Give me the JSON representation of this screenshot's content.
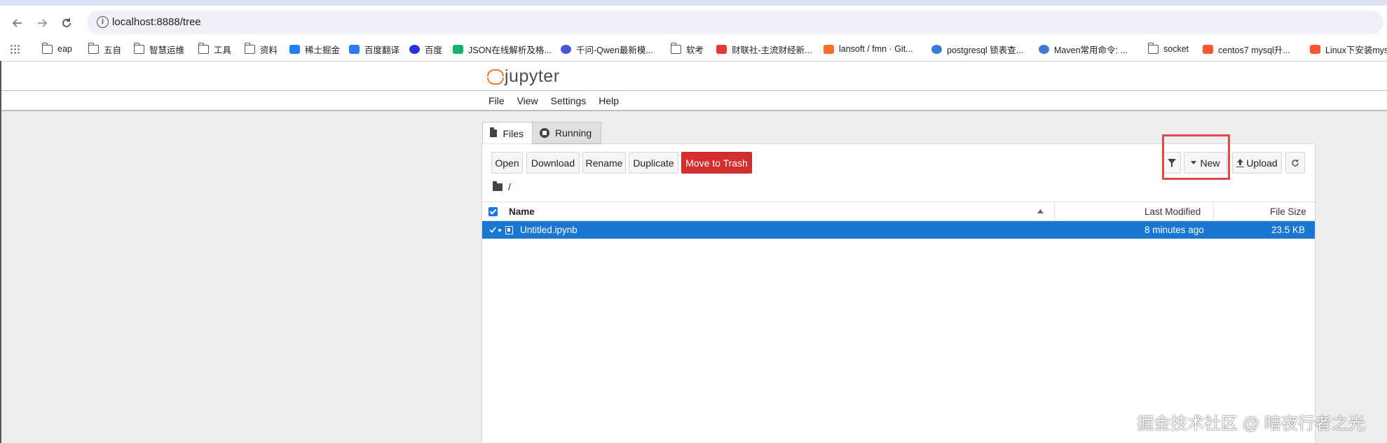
{
  "browser": {
    "url": "localhost:8888/tree",
    "bookmarks": [
      {
        "label": "eap",
        "icon": "folder-icon"
      },
      {
        "label": "五自",
        "icon": "folder-icon"
      },
      {
        "label": "智慧运维",
        "icon": "folder-icon"
      },
      {
        "label": "工具",
        "icon": "folder-icon"
      },
      {
        "label": "资料",
        "icon": "folder-icon"
      },
      {
        "label": "稀土掘金",
        "icon": "juejin-icon"
      },
      {
        "label": "百度翻译",
        "icon": "baidu-translate-icon"
      },
      {
        "label": "百度",
        "icon": "baidu-icon"
      },
      {
        "label": "JSON在线解析及格...",
        "icon": "json-icon"
      },
      {
        "label": "千问-Qwen最新模...",
        "icon": "qwen-icon"
      },
      {
        "label": "软考",
        "icon": "folder-icon"
      },
      {
        "label": "财联社-主流财经新...",
        "icon": "cailianshe-icon"
      },
      {
        "label": "lansoft / fmn · Git...",
        "icon": "gitlab-icon"
      },
      {
        "label": "postgresql 锁表查...",
        "icon": "web-icon"
      },
      {
        "label": "Maven常用命令: ...",
        "icon": "web-icon"
      },
      {
        "label": "socket",
        "icon": "folder-icon"
      },
      {
        "label": "centos7 mysql升...",
        "icon": "csdn-icon"
      },
      {
        "label": "Linux下安装mys",
        "icon": "csdn-icon"
      }
    ]
  },
  "app": {
    "logo_text": "jupyter",
    "menu": [
      "File",
      "View",
      "Settings",
      "Help"
    ],
    "tabs": [
      {
        "label": "Files",
        "icon": "folder-icon",
        "active": true
      },
      {
        "label": "Running",
        "icon": "stop-circle-icon",
        "active": false
      }
    ],
    "toolbar": {
      "open": "Open",
      "download": "Download",
      "rename": "Rename",
      "duplicate": "Duplicate",
      "trash": "Move to Trash",
      "new": "New",
      "upload": "Upload"
    },
    "breadcrumb": "/",
    "columns": {
      "name": "Name",
      "modified": "Last Modified",
      "size": "File Size"
    },
    "files": [
      {
        "name": "Untitled.ipynb",
        "modified": "8 minutes ago",
        "size": "23.5 KB",
        "selected": true,
        "running": true
      }
    ]
  },
  "watermark": "掘金技术社区 @ 暗夜行者之光",
  "colors": {
    "accent": "#1976d2",
    "danger": "#d32f2f",
    "highlight": "#e0484b",
    "jupyter_orange": "#f37726"
  }
}
